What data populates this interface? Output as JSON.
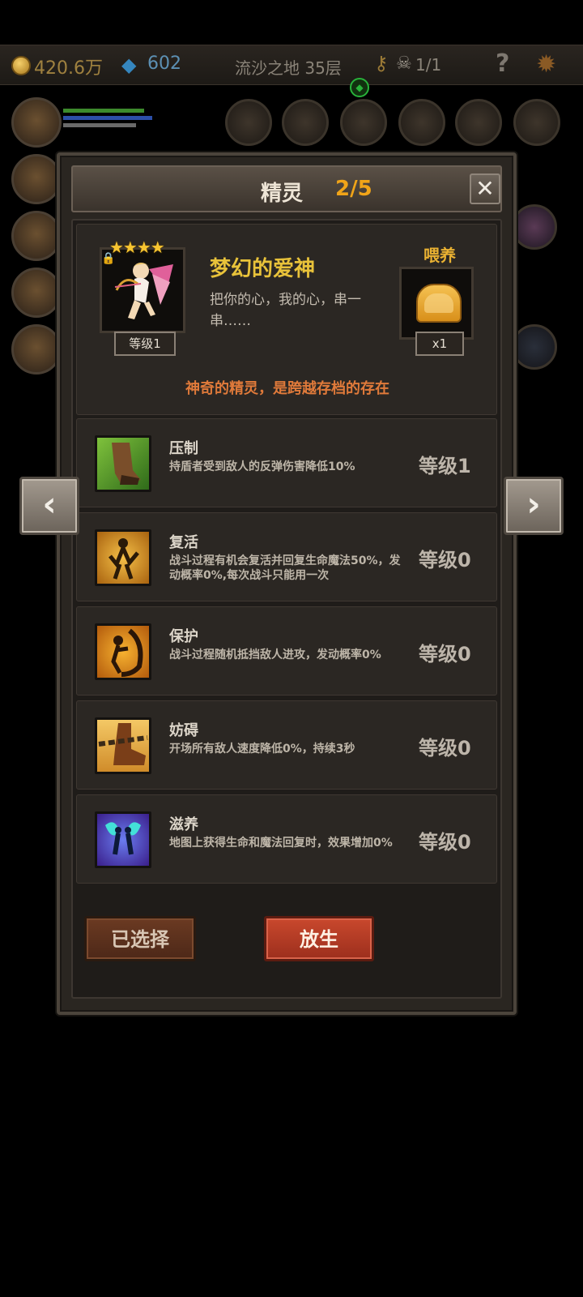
{
  "topbar": {
    "gold": "420.6万",
    "gems": "602",
    "level_name": "流沙之地 35层",
    "kills": "1/1",
    "help": "?"
  },
  "dialog": {
    "title": "精灵",
    "count": "2/5",
    "close": "✕"
  },
  "sprite": {
    "stars": "★★★★",
    "level_badge": "等级1",
    "name": "梦幻的爱神",
    "description": "把你的心，我的心，串一串……",
    "feed_label": "喂养",
    "feed_qty": "x1",
    "tagline": "神奇的精灵，是跨越存档的存在"
  },
  "skills": [
    {
      "name": "压制",
      "desc": "持盾者受到敌人的反弹伤害降低10%",
      "level": "等级1",
      "icon": "hoof-icon"
    },
    {
      "name": "复活",
      "desc": "战斗过程有机会复活并回复生命魔法50%，发动概率0%,每次战斗只能用一次",
      "level": "等级0",
      "icon": "revive-icon"
    },
    {
      "name": "保护",
      "desc": "战斗过程随机抵挡敌人进攻，发动概率0%",
      "level": "等级0",
      "icon": "protect-icon"
    },
    {
      "name": "妨碍",
      "desc": "开场所有敌人速度降低0%，持续3秒",
      "level": "等级0",
      "icon": "chained-boot-icon"
    },
    {
      "name": "滋养",
      "desc": "地图上获得生命和魔法回复时，效果增加0%",
      "level": "等级0",
      "icon": "fairy-icon"
    }
  ],
  "buttons": {
    "selected": "已选择",
    "release": "放生",
    "prev": "‹",
    "next": "›"
  },
  "colors": {
    "accent_orange": "#f0a418",
    "name_gold": "#e8c23a",
    "tagline": "#e07a3a",
    "release_red": "#c9482d"
  }
}
